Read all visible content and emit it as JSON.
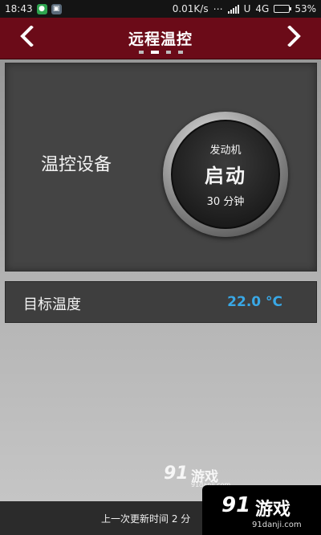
{
  "status_bar": {
    "time": "18:43",
    "network_speed": "0.01K/s",
    "carrier": "U",
    "network_type": "4G",
    "battery": "53%",
    "battery_level": 0.53,
    "icons": [
      "notification-icon",
      "shield-icon",
      "signal-icon",
      "battery-icon"
    ]
  },
  "header": {
    "title": "远程温控",
    "page_count": 4,
    "active_page": 2,
    "background_color": "#6b0b18"
  },
  "device_panel": {
    "label": "温控设备",
    "engine_button": {
      "label": "发动机",
      "action": "启动",
      "duration": "30 分钟"
    }
  },
  "target_temperature": {
    "label": "目标温度",
    "value": "22.0 °C",
    "value_color": "#39a8e6"
  },
  "footer": {
    "update_text": "上一次更新时间 2 分"
  },
  "watermark": {
    "logo": "91",
    "text": "游戏",
    "url": "91danji.com"
  }
}
